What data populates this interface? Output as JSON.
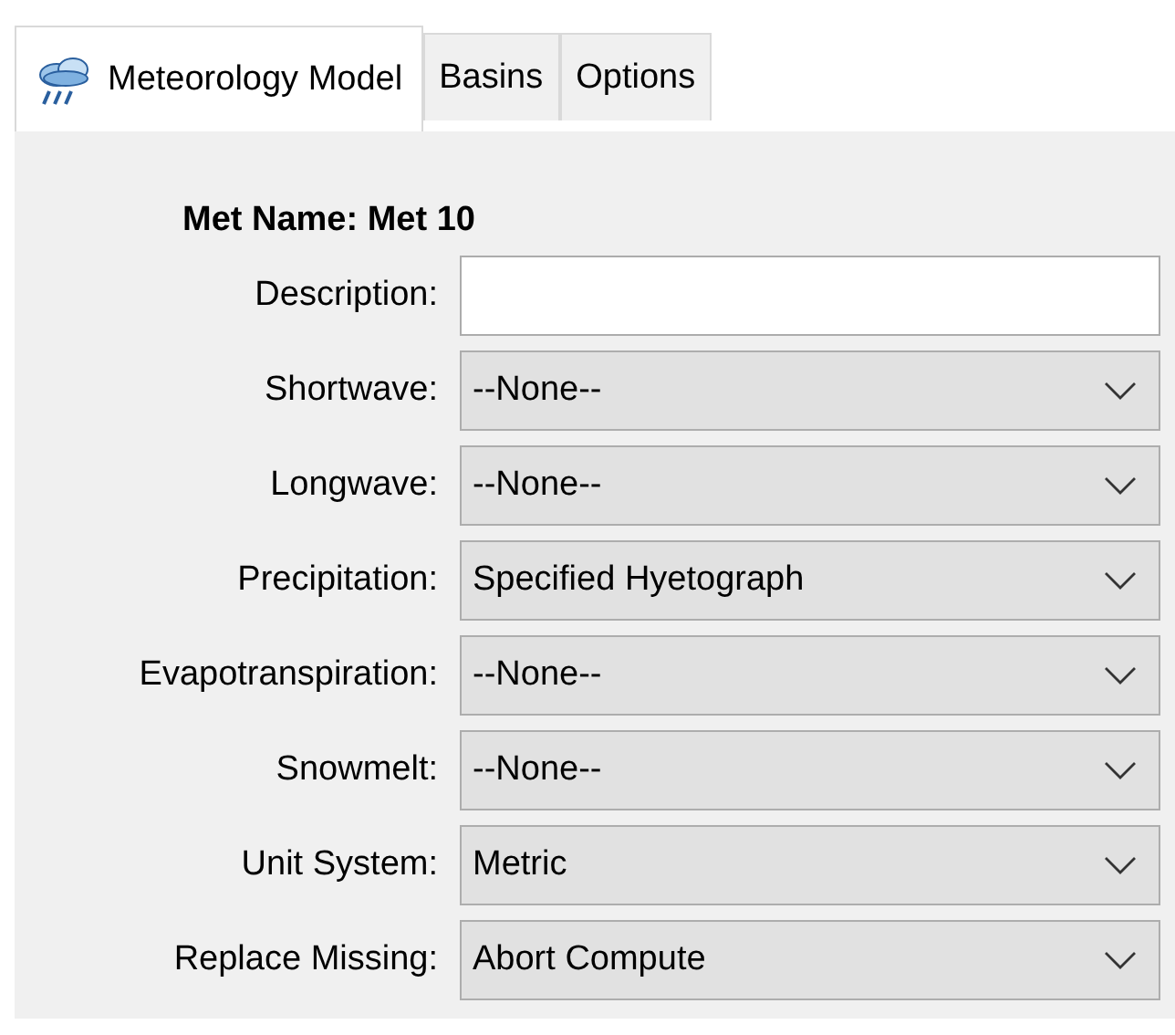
{
  "tabs": [
    {
      "label": "Meteorology Model",
      "selected": true,
      "icon": true
    },
    {
      "label": "Basins",
      "selected": false,
      "icon": false
    },
    {
      "label": "Options",
      "selected": false,
      "icon": false
    }
  ],
  "met_name": "Met Name: Met 10",
  "fields": [
    {
      "kind": "text",
      "label": "Description:"
    },
    {
      "kind": "dropdown",
      "label": "Shortwave:",
      "value": "--None--"
    },
    {
      "kind": "dropdown",
      "label": "Longwave:",
      "value": "--None--"
    },
    {
      "kind": "dropdown",
      "label": "Precipitation:",
      "value": "Specified Hyetograph"
    },
    {
      "kind": "dropdown",
      "label": "Evapotranspiration:",
      "value": "--None--"
    },
    {
      "kind": "dropdown",
      "label": "Snowmelt:",
      "value": "--None--"
    },
    {
      "kind": "dropdown",
      "label": "Unit System:",
      "value": "Metric"
    },
    {
      "kind": "dropdown",
      "label": "Replace Missing:",
      "value": "Abort Compute"
    }
  ]
}
